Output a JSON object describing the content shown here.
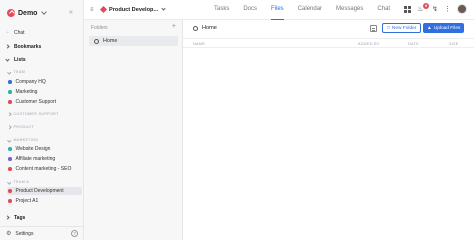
{
  "app": {
    "workspace_name": "Demo"
  },
  "sidebar": {
    "chat": "Chat",
    "bookmarks": "Bookmarks",
    "lists": "Lists",
    "sections": [
      {
        "label": "TEAM",
        "items": [
          {
            "label": "Company HQ",
            "color": "#2f6fe0"
          },
          {
            "label": "Marketing",
            "color": "#2bb3a6"
          },
          {
            "label": "Customer Support",
            "color": "#e54a5b"
          }
        ]
      },
      {
        "label": "CUSTOMER SUPPORT",
        "items": []
      },
      {
        "label": "PRODUCT",
        "items": []
      },
      {
        "label": "MARKETING",
        "items": [
          {
            "label": "Website Design",
            "color": "#2bb3a6"
          },
          {
            "label": "Affiliate marketing",
            "color": "#7b5cd6"
          },
          {
            "label": "Content marketing - SEO",
            "color": "#e54a5b"
          }
        ]
      },
      {
        "label": "TEAM A",
        "items": [
          {
            "label": "Product Development",
            "color": "#e54a5b",
            "active": true
          },
          {
            "label": "Project A1",
            "color": "#e54a5b"
          }
        ]
      }
    ],
    "tags": "Tags",
    "settings": "Settings"
  },
  "topbar": {
    "project_title": "Product Develop...",
    "tabs": [
      "Tasks",
      "Docs",
      "Files",
      "Calendar",
      "Messages",
      "Chat"
    ],
    "active_tab": "Files",
    "notification_count": "9"
  },
  "folders": {
    "header": "Folders",
    "items": [
      "Home"
    ]
  },
  "files": {
    "breadcrumb": "Home",
    "new_folder_label": "New Folder",
    "upload_label": "Upload Files",
    "columns": {
      "name": "NAME",
      "added_by": "ADDED BY",
      "date": "DATE",
      "size": "SIZE"
    }
  },
  "colors": {
    "accent": "#2f6fe0",
    "brand": "#e54a5b"
  }
}
